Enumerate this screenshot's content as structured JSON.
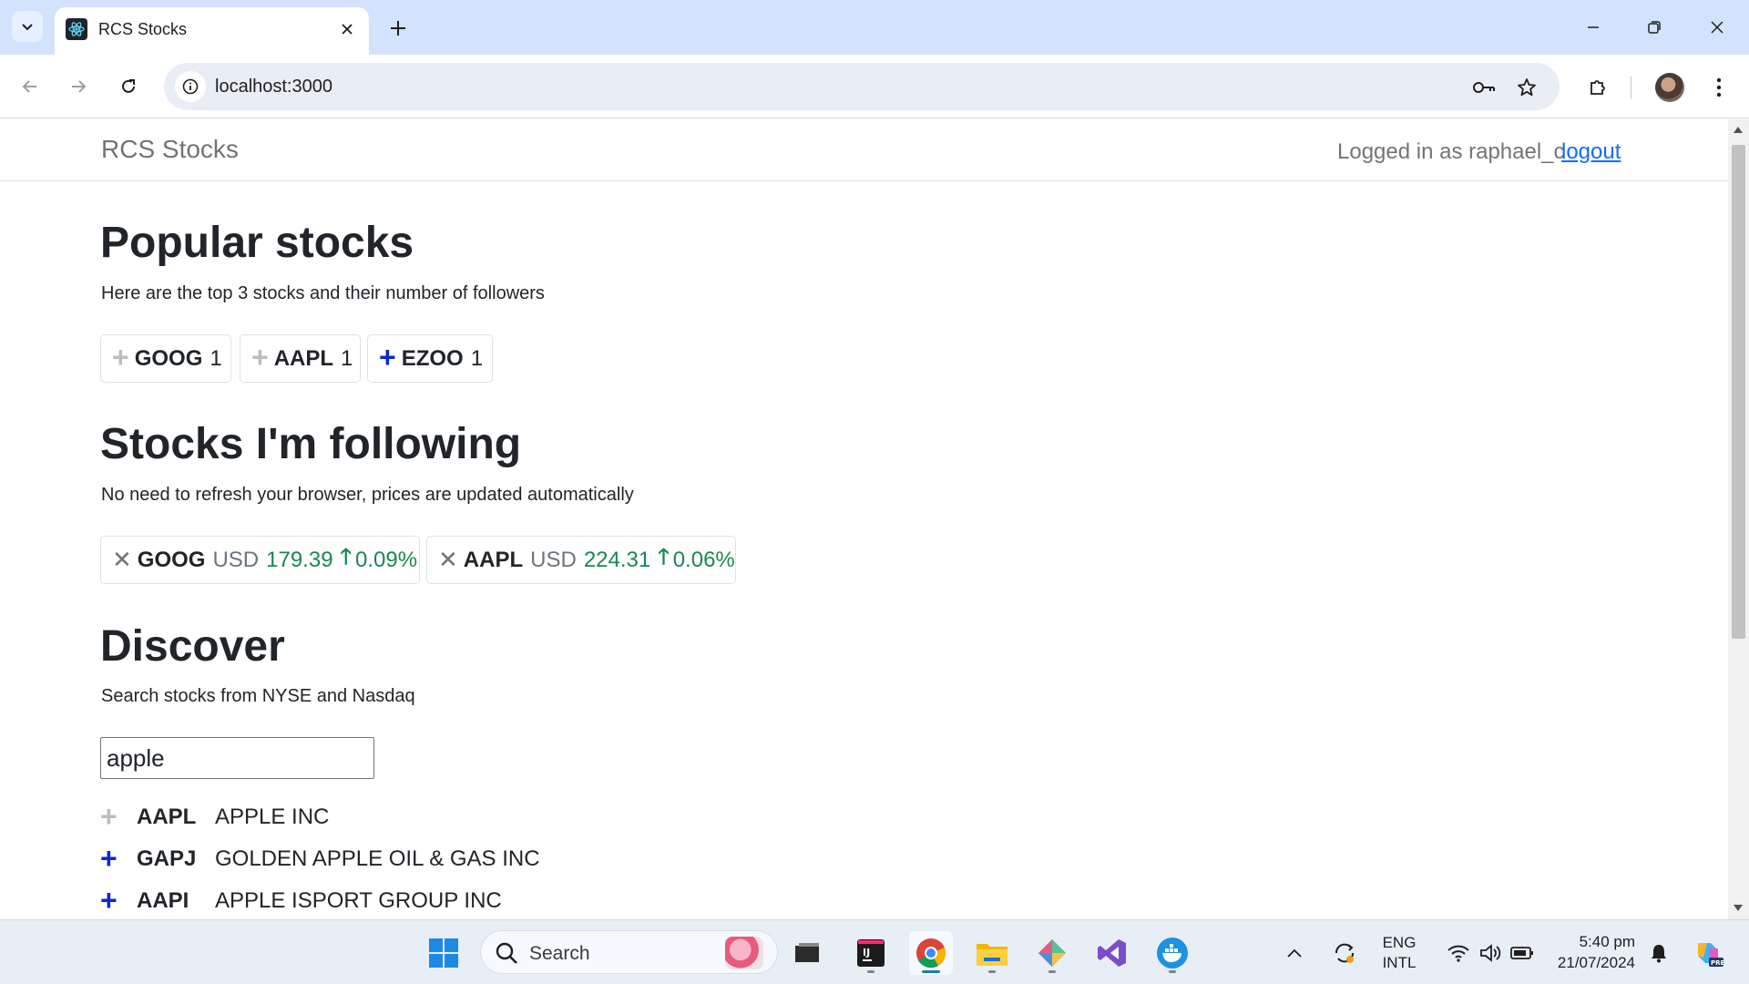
{
  "browser": {
    "tab_title": "RCS Stocks",
    "url": "localhost:3000"
  },
  "app": {
    "brand": "RCS Stocks",
    "logged_in_text": "Logged in as raphael_c",
    "logout_label": "logout"
  },
  "popular": {
    "heading": "Popular stocks",
    "subtitle": "Here are the top 3 stocks and their number of followers",
    "stocks": [
      {
        "symbol": "GOOG",
        "followers": "1",
        "followed": true
      },
      {
        "symbol": "AAPL",
        "followers": "1",
        "followed": true
      },
      {
        "symbol": "EZOO",
        "followers": "1",
        "followed": false
      }
    ]
  },
  "following": {
    "heading": "Stocks I'm following",
    "subtitle": "No need to refresh your browser, prices are updated automatically",
    "stocks": [
      {
        "symbol": "GOOG",
        "currency": "USD",
        "price": "179.39",
        "change": "0.09%",
        "direction": "up"
      },
      {
        "symbol": "AAPL",
        "currency": "USD",
        "price": "224.31",
        "change": "0.06%",
        "direction": "up"
      }
    ]
  },
  "discover": {
    "heading": "Discover",
    "subtitle": "Search stocks from NYSE and Nasdaq",
    "search_value": "apple",
    "results": [
      {
        "symbol": "AAPL",
        "name": "APPLE INC",
        "followed": true
      },
      {
        "symbol": "GAPJ",
        "name": "GOLDEN APPLE OIL & GAS INC",
        "followed": false
      },
      {
        "symbol": "AAPI",
        "name": "APPLE ISPORT GROUP INC",
        "followed": false
      }
    ]
  },
  "taskbar": {
    "search_placeholder": "Search",
    "language_line1": "ENG",
    "language_line2": "INTL",
    "time": "5:40 pm",
    "date": "21/07/2024"
  },
  "colors": {
    "follow_active": "#0d26d6",
    "follow_inactive": "#bdbdbd",
    "price_up": "#198754",
    "link": "#0d6efd"
  }
}
